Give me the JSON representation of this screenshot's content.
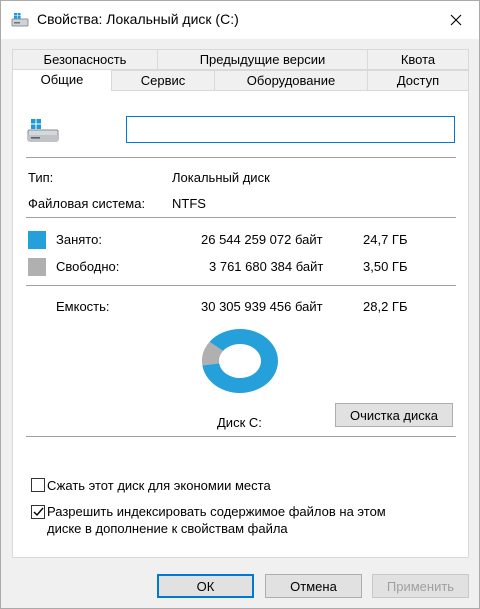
{
  "window": {
    "title": "Свойства: Локальный диск (C:)",
    "close_icon": "close-icon"
  },
  "tabs": {
    "row1": [
      "Безопасность",
      "Предыдущие версии",
      "Квота"
    ],
    "row2": [
      "Общие",
      "Сервис",
      "Оборудование",
      "Доступ"
    ],
    "active": "Общие"
  },
  "general": {
    "drive_name_value": "",
    "type_label": "Тип:",
    "type_value": "Локальный диск",
    "fs_label": "Файловая система:",
    "fs_value": "NTFS",
    "used": {
      "label": "Занято:",
      "bytes": "26 544 259 072 байт",
      "size": "24,7 ГБ",
      "color": "#26a0da"
    },
    "free": {
      "label": "Свободно:",
      "bytes": "3 761 680 384 байт",
      "size": "3,50 ГБ",
      "color": "#b0b0b0"
    },
    "capacity": {
      "label": "Емкость:",
      "bytes": "30 305 939 456 байт",
      "size": "28,2 ГБ"
    },
    "used_fraction": 0.8759,
    "disk_label": "Диск C:",
    "cleanup_button": "Очистка диска",
    "compress_label": "Сжать этот диск для экономии места",
    "compress_checked": false,
    "index_label_line1": "Разрешить индексировать содержимое файлов на этом",
    "index_label_line2": "диске в дополнение к свойствам файла",
    "index_checked": true
  },
  "buttons": {
    "ok": "ОК",
    "cancel": "Отмена",
    "apply": "Применить"
  }
}
